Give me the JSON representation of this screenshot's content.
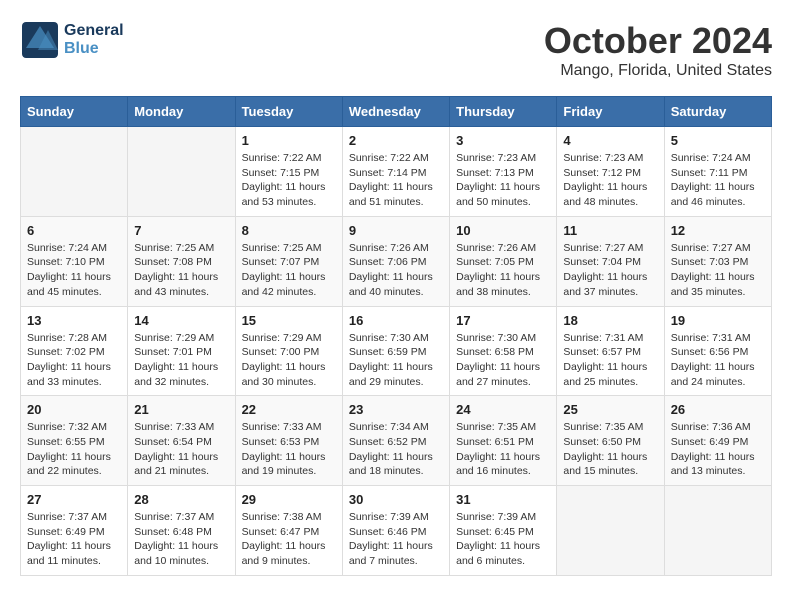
{
  "header": {
    "logo_line1": "General",
    "logo_line2": "Blue",
    "title": "October 2024",
    "subtitle": "Mango, Florida, United States"
  },
  "days_of_week": [
    "Sunday",
    "Monday",
    "Tuesday",
    "Wednesday",
    "Thursday",
    "Friday",
    "Saturday"
  ],
  "weeks": [
    [
      {
        "day": "",
        "info": ""
      },
      {
        "day": "",
        "info": ""
      },
      {
        "day": "1",
        "info": "Sunrise: 7:22 AM\nSunset: 7:15 PM\nDaylight: 11 hours and 53 minutes."
      },
      {
        "day": "2",
        "info": "Sunrise: 7:22 AM\nSunset: 7:14 PM\nDaylight: 11 hours and 51 minutes."
      },
      {
        "day": "3",
        "info": "Sunrise: 7:23 AM\nSunset: 7:13 PM\nDaylight: 11 hours and 50 minutes."
      },
      {
        "day": "4",
        "info": "Sunrise: 7:23 AM\nSunset: 7:12 PM\nDaylight: 11 hours and 48 minutes."
      },
      {
        "day": "5",
        "info": "Sunrise: 7:24 AM\nSunset: 7:11 PM\nDaylight: 11 hours and 46 minutes."
      }
    ],
    [
      {
        "day": "6",
        "info": "Sunrise: 7:24 AM\nSunset: 7:10 PM\nDaylight: 11 hours and 45 minutes."
      },
      {
        "day": "7",
        "info": "Sunrise: 7:25 AM\nSunset: 7:08 PM\nDaylight: 11 hours and 43 minutes."
      },
      {
        "day": "8",
        "info": "Sunrise: 7:25 AM\nSunset: 7:07 PM\nDaylight: 11 hours and 42 minutes."
      },
      {
        "day": "9",
        "info": "Sunrise: 7:26 AM\nSunset: 7:06 PM\nDaylight: 11 hours and 40 minutes."
      },
      {
        "day": "10",
        "info": "Sunrise: 7:26 AM\nSunset: 7:05 PM\nDaylight: 11 hours and 38 minutes."
      },
      {
        "day": "11",
        "info": "Sunrise: 7:27 AM\nSunset: 7:04 PM\nDaylight: 11 hours and 37 minutes."
      },
      {
        "day": "12",
        "info": "Sunrise: 7:27 AM\nSunset: 7:03 PM\nDaylight: 11 hours and 35 minutes."
      }
    ],
    [
      {
        "day": "13",
        "info": "Sunrise: 7:28 AM\nSunset: 7:02 PM\nDaylight: 11 hours and 33 minutes."
      },
      {
        "day": "14",
        "info": "Sunrise: 7:29 AM\nSunset: 7:01 PM\nDaylight: 11 hours and 32 minutes."
      },
      {
        "day": "15",
        "info": "Sunrise: 7:29 AM\nSunset: 7:00 PM\nDaylight: 11 hours and 30 minutes."
      },
      {
        "day": "16",
        "info": "Sunrise: 7:30 AM\nSunset: 6:59 PM\nDaylight: 11 hours and 29 minutes."
      },
      {
        "day": "17",
        "info": "Sunrise: 7:30 AM\nSunset: 6:58 PM\nDaylight: 11 hours and 27 minutes."
      },
      {
        "day": "18",
        "info": "Sunrise: 7:31 AM\nSunset: 6:57 PM\nDaylight: 11 hours and 25 minutes."
      },
      {
        "day": "19",
        "info": "Sunrise: 7:31 AM\nSunset: 6:56 PM\nDaylight: 11 hours and 24 minutes."
      }
    ],
    [
      {
        "day": "20",
        "info": "Sunrise: 7:32 AM\nSunset: 6:55 PM\nDaylight: 11 hours and 22 minutes."
      },
      {
        "day": "21",
        "info": "Sunrise: 7:33 AM\nSunset: 6:54 PM\nDaylight: 11 hours and 21 minutes."
      },
      {
        "day": "22",
        "info": "Sunrise: 7:33 AM\nSunset: 6:53 PM\nDaylight: 11 hours and 19 minutes."
      },
      {
        "day": "23",
        "info": "Sunrise: 7:34 AM\nSunset: 6:52 PM\nDaylight: 11 hours and 18 minutes."
      },
      {
        "day": "24",
        "info": "Sunrise: 7:35 AM\nSunset: 6:51 PM\nDaylight: 11 hours and 16 minutes."
      },
      {
        "day": "25",
        "info": "Sunrise: 7:35 AM\nSunset: 6:50 PM\nDaylight: 11 hours and 15 minutes."
      },
      {
        "day": "26",
        "info": "Sunrise: 7:36 AM\nSunset: 6:49 PM\nDaylight: 11 hours and 13 minutes."
      }
    ],
    [
      {
        "day": "27",
        "info": "Sunrise: 7:37 AM\nSunset: 6:49 PM\nDaylight: 11 hours and 11 minutes."
      },
      {
        "day": "28",
        "info": "Sunrise: 7:37 AM\nSunset: 6:48 PM\nDaylight: 11 hours and 10 minutes."
      },
      {
        "day": "29",
        "info": "Sunrise: 7:38 AM\nSunset: 6:47 PM\nDaylight: 11 hours and 9 minutes."
      },
      {
        "day": "30",
        "info": "Sunrise: 7:39 AM\nSunset: 6:46 PM\nDaylight: 11 hours and 7 minutes."
      },
      {
        "day": "31",
        "info": "Sunrise: 7:39 AM\nSunset: 6:45 PM\nDaylight: 11 hours and 6 minutes."
      },
      {
        "day": "",
        "info": ""
      },
      {
        "day": "",
        "info": ""
      }
    ]
  ]
}
